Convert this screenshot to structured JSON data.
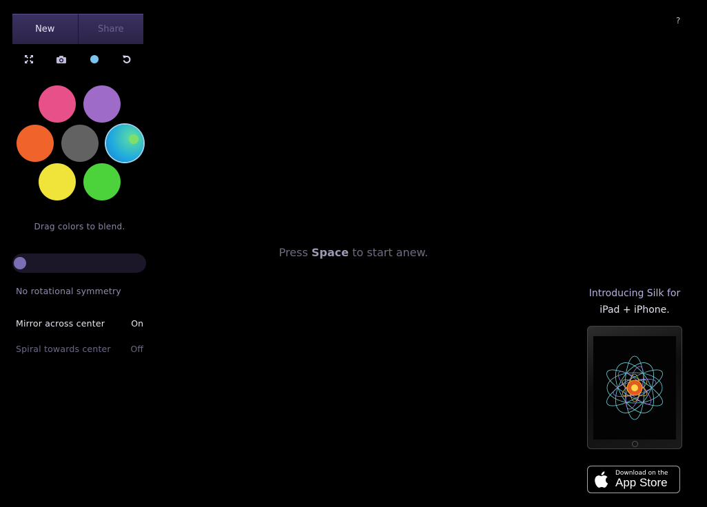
{
  "toolbar": {
    "new_label": "New",
    "share_label": "Share",
    "tools": [
      "fullscreen-icon",
      "camera-icon",
      "color-dot-icon",
      "undo-icon"
    ]
  },
  "palette": {
    "colors": [
      {
        "name": "pink",
        "hex": "#e8508a"
      },
      {
        "name": "purple",
        "hex": "#9e6cc8"
      },
      {
        "name": "orange",
        "hex": "#f0632a"
      },
      {
        "name": "gray",
        "hex": "#626262"
      },
      {
        "name": "teal",
        "hex": "#22b4d8"
      },
      {
        "name": "yellow",
        "hex": "#f0e43a"
      },
      {
        "name": "green",
        "hex": "#4cd23a"
      }
    ],
    "selected": "teal",
    "hint": "Drag colors to blend."
  },
  "symmetry": {
    "label": "No rotational symmetry",
    "value": 0
  },
  "options": [
    {
      "label": "Mirror across center",
      "value": "On"
    },
    {
      "label": "Spiral towards center",
      "value": "Off"
    }
  ],
  "canvas": {
    "message_prefix": "Press ",
    "message_key": "Space",
    "message_suffix": " to start anew."
  },
  "help_label": "?",
  "promo": {
    "line1": "Introducing Silk for",
    "line2": "iPad + iPhone.",
    "badge_small": "Download on the",
    "badge_big": "App Store"
  },
  "colors": {
    "background": "#000000",
    "accent": "#7b6eb4"
  }
}
